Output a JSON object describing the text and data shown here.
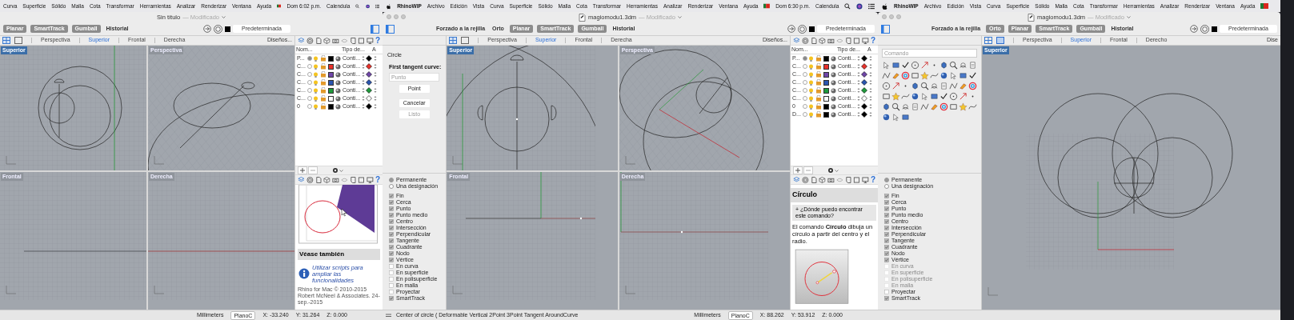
{
  "windows": [
    {
      "single_view": false,
      "menu_bar": {
        "items": [
          "Curva",
          "Superficie",
          "Sólido",
          "Malla",
          "Cota",
          "Transformar",
          "Herramientas",
          "Analizar",
          "Renderizar",
          "Ventana",
          "Ayuda"
        ],
        "clock": "Dom 6:02 p.m.",
        "user": "Calendula"
      },
      "title": "Sin título",
      "title_status": "— Modificado",
      "toggles": [
        {
          "label": "Planar",
          "on": true
        },
        {
          "label": "SmartTrack",
          "on": true
        },
        {
          "label": "Gumball",
          "on": true
        },
        {
          "label": "Historial",
          "on": false
        }
      ],
      "layer_field": "Predeterminada",
      "view_tabs": [
        {
          "label": "Perspectiva",
          "selected": false
        },
        {
          "label": "Superior",
          "selected": true
        },
        {
          "label": "Frontal",
          "selected": false
        },
        {
          "label": "Derecha",
          "selected": false
        }
      ],
      "layouts_button": "Diseños...",
      "viewports": [
        {
          "label": "Superior",
          "active": true,
          "kind": "top"
        },
        {
          "label": "Perspectiva",
          "active": false,
          "kind": "perspective"
        },
        {
          "label": "Frontal",
          "active": false,
          "kind": "front"
        },
        {
          "label": "Derecha",
          "active": false,
          "kind": "right"
        }
      ],
      "help_tab_glyph": "?",
      "layers": {
        "columns": [
          "Nom...",
          "Tipo de...",
          "A"
        ],
        "rows": [
          {
            "name": "P...",
            "current": true,
            "color": "#000000",
            "linetype": "Conti..."
          },
          {
            "name": "C...",
            "current": false,
            "color": "#e8312a",
            "linetype": "Conti..."
          },
          {
            "name": "C...",
            "current": false,
            "color": "#6f46a8",
            "linetype": "Conti..."
          },
          {
            "name": "C...",
            "current": false,
            "color": "#2a55b0",
            "linetype": "Conti..."
          },
          {
            "name": "C...",
            "current": false,
            "color": "#1f9a3b",
            "linetype": "Conti..."
          },
          {
            "name": "C...",
            "current": false,
            "color": "#ffffff",
            "linetype": "Conti..."
          },
          {
            "name": "0",
            "current": false,
            "color": "#000000",
            "linetype": "Conti..."
          }
        ]
      },
      "help": {
        "kind": "see_also",
        "heading": "Véase también",
        "link": "Utilizar scripts para ampliar las funcionalidades",
        "footer": "Rhino for Mac © 2010-2015 Robert McNeel & Associates. 24-sep.-2015"
      },
      "status_bar": {
        "units": "Millimeters",
        "cplane": "PlanoC",
        "x": "X: -33.240",
        "y": "Y: 31.264",
        "z": "Z: 0.000"
      }
    },
    {
      "traffic_lights": true,
      "document_icon": true,
      "single_view": false,
      "menu_bar": {
        "app_name": "RhinoWIP",
        "items": [
          "Archivo",
          "Edición",
          "Vista",
          "Curva",
          "Superficie",
          "Sólido",
          "Malla",
          "Cota",
          "Transformar",
          "Herramientas",
          "Analizar",
          "Renderizar",
          "Ventana",
          "Ayuda"
        ],
        "clock": "Dom 6:30 p.m.",
        "user": "Calendula"
      },
      "title": "magiomodu1.3dm",
      "title_status": "— Modificado",
      "toggles": [
        {
          "label": "Forzado a la rejilla",
          "on": false
        },
        {
          "label": "Orto",
          "on": false
        },
        {
          "label": "Planar",
          "on": true
        },
        {
          "label": "SmartTrack",
          "on": true
        },
        {
          "label": "Gumball",
          "on": true
        },
        {
          "label": "Historial",
          "on": false
        }
      ],
      "layer_field": "Predeterminada",
      "view_tabs": [
        {
          "label": "Perspectiva",
          "selected": false
        },
        {
          "label": "Superior",
          "selected": true
        },
        {
          "label": "Frontal",
          "selected": false
        },
        {
          "label": "Derecha",
          "selected": false
        }
      ],
      "layouts_button": "Diseños...",
      "viewports": [
        {
          "label": "Superior",
          "active": true,
          "kind": "top"
        },
        {
          "label": "Perspectiva",
          "active": false,
          "kind": "perspective"
        },
        {
          "label": "Frontal",
          "active": false,
          "kind": "front"
        },
        {
          "label": "Derecha",
          "active": false,
          "kind": "right"
        }
      ],
      "command": {
        "name": "Circle",
        "prompt": "First tangent curve:",
        "placeholder": "Punto",
        "buttons": [
          {
            "label": "Point",
            "disabled": false
          },
          {
            "label": "Cancelar",
            "disabled": false
          },
          {
            "label": "Listo",
            "disabled": true
          }
        ]
      },
      "osnap_modes": [
        {
          "label": "Permanente",
          "selected": true
        },
        {
          "label": "Una designación",
          "selected": false
        }
      ],
      "osnaps": [
        {
          "label": "Fin",
          "checked": true,
          "disabled": false
        },
        {
          "label": "Cerca",
          "checked": true,
          "disabled": false
        },
        {
          "label": "Punto",
          "checked": true,
          "disabled": false
        },
        {
          "label": "Punto medio",
          "checked": true,
          "disabled": false
        },
        {
          "label": "Centro",
          "checked": true,
          "disabled": false
        },
        {
          "label": "Intersección",
          "checked": true,
          "disabled": false
        },
        {
          "label": "Perpendicular",
          "checked": true,
          "disabled": false
        },
        {
          "label": "Tangente",
          "checked": true,
          "disabled": false
        },
        {
          "label": "Cuadrante",
          "checked": true,
          "disabled": false
        },
        {
          "label": "Nodo",
          "checked": true,
          "disabled": false
        },
        {
          "label": "Vértice",
          "checked": true,
          "disabled": false
        },
        {
          "label": "En curva",
          "checked": false,
          "disabled": false
        },
        {
          "label": "En superficie",
          "checked": false,
          "disabled": false
        },
        {
          "label": "En polisuperficie",
          "checked": false,
          "disabled": false
        },
        {
          "label": "En malla",
          "checked": false,
          "disabled": false
        },
        {
          "label": "Proyectar",
          "checked": false,
          "disabled": false
        },
        {
          "label": "SmartTrack",
          "checked": true,
          "disabled": false
        }
      ],
      "help_tab_glyph": "?",
      "layers": {
        "columns": [
          "Nom...",
          "Tipo de...",
          "A"
        ],
        "rows": [
          {
            "name": "P...",
            "current": true,
            "color": "#000000",
            "linetype": "Conti..."
          },
          {
            "name": "C...",
            "current": false,
            "color": "#e8312a",
            "linetype": "Conti..."
          },
          {
            "name": "C...",
            "current": false,
            "color": "#6f46a8",
            "linetype": "Conti..."
          },
          {
            "name": "C...",
            "current": false,
            "color": "#2a55b0",
            "linetype": "Conti..."
          },
          {
            "name": "C...",
            "current": false,
            "color": "#1f9a3b",
            "linetype": "Conti..."
          },
          {
            "name": "C...",
            "current": false,
            "color": "#ffffff",
            "linetype": "Conti..."
          },
          {
            "name": "0",
            "current": false,
            "color": "#000000",
            "linetype": "Conti..."
          },
          {
            "name": "D...",
            "current": false,
            "color": "#000000",
            "linetype": "Conti..."
          }
        ]
      },
      "help": {
        "kind": "command",
        "heading": "Círculo",
        "faq": "+ ¿Dónde puedo encontrar este comando?",
        "body": "El comando **Círculo** dibuja un círculo a partir del centro y el radio."
      },
      "status_bar": {
        "prompt": "Center of circle ( Deformable Vertical 2Point 3Point Tangent AroundCurve",
        "units": "Millimeters",
        "cplane": "PlanoC",
        "x": "X: 88.262",
        "y": "Y: 53.912",
        "z": "Z: 0.000"
      }
    },
    {
      "traffic_lights": true,
      "document_icon": true,
      "single_view": true,
      "menu_bar": {
        "app_name": "RhinoWIP",
        "items": [
          "Archivo",
          "Edición",
          "Vista",
          "Curva",
          "Superficie",
          "Sólido",
          "Malla",
          "Cota",
          "Transformar",
          "Herramientas",
          "Analizar",
          "Renderizar",
          "Ventana",
          "Ayuda"
        ]
      },
      "title": "magiomodu1.3dm",
      "title_status": "— Modificado",
      "toggles": [
        {
          "label": "Forzado a la rejilla",
          "on": false
        },
        {
          "label": "Orto",
          "on": true
        },
        {
          "label": "Planar",
          "on": true
        },
        {
          "label": "SmartTrack",
          "on": true
        },
        {
          "label": "Gumball",
          "on": true
        },
        {
          "label": "Historial",
          "on": false
        }
      ],
      "layer_field": "Predeterminada",
      "view_tabs": [
        {
          "label": "Perspectiva",
          "selected": false
        },
        {
          "label": "Superior",
          "selected": true
        },
        {
          "label": "Frontal",
          "selected": false
        },
        {
          "label": "Derecho",
          "selected": false
        }
      ],
      "layouts_button": "Dise",
      "viewports": [
        {
          "label": "Superior",
          "active": true,
          "kind": "top"
        }
      ],
      "command_field": {
        "placeholder": "Comando"
      },
      "osnap_modes": [
        {
          "label": "Permanente",
          "selected": true
        },
        {
          "label": "Una designación",
          "selected": false
        }
      ],
      "osnaps": [
        {
          "label": "Fin",
          "checked": true,
          "disabled": false
        },
        {
          "label": "Cerca",
          "checked": true,
          "disabled": false
        },
        {
          "label": "Punto",
          "checked": true,
          "disabled": false
        },
        {
          "label": "Punto medio",
          "checked": true,
          "disabled": false
        },
        {
          "label": "Centro",
          "checked": true,
          "disabled": false
        },
        {
          "label": "Intersección",
          "checked": true,
          "disabled": false
        },
        {
          "label": "Perpendicular",
          "checked": true,
          "disabled": false
        },
        {
          "label": "Tangente",
          "checked": true,
          "disabled": false
        },
        {
          "label": "Cuadrante",
          "checked": true,
          "disabled": false
        },
        {
          "label": "Nodo",
          "checked": true,
          "disabled": false
        },
        {
          "label": "Vértice",
          "checked": true,
          "disabled": false
        },
        {
          "label": "En curva",
          "checked": false,
          "disabled": true
        },
        {
          "label": "En superficie",
          "checked": false,
          "disabled": true
        },
        {
          "label": "En polisuperficie",
          "checked": false,
          "disabled": true
        },
        {
          "label": "En malla",
          "checked": false,
          "disabled": true
        },
        {
          "label": "Proyectar",
          "checked": false,
          "disabled": false
        },
        {
          "label": "SmartTrack",
          "checked": true,
          "disabled": false
        }
      ]
    }
  ]
}
